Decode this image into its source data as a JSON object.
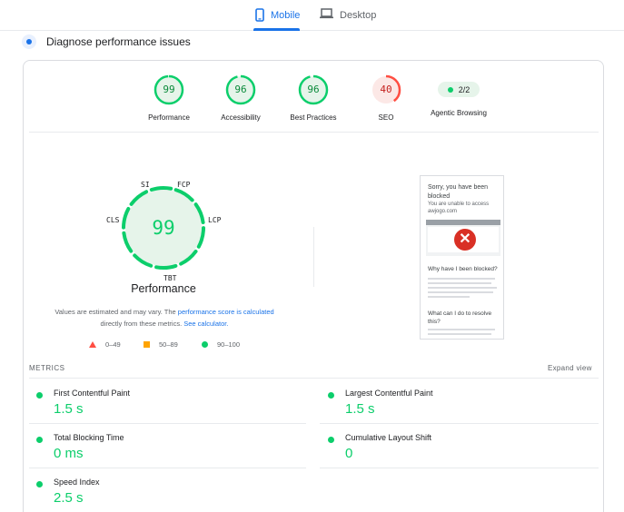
{
  "tabs": [
    {
      "label": "Mobile",
      "icon": "smartphone-icon",
      "active": true
    },
    {
      "label": "Desktop",
      "icon": "laptop-icon",
      "active": false
    }
  ],
  "diagnose": {
    "title": "Diagnose performance issues"
  },
  "scores": [
    {
      "value": "99",
      "label": "Performance",
      "status": "pass"
    },
    {
      "value": "96",
      "label": "Accessibility",
      "status": "pass"
    },
    {
      "value": "96",
      "label": "Best Practices",
      "status": "pass"
    },
    {
      "value": "40",
      "label": "SEO",
      "status": "fail"
    }
  ],
  "agentic": {
    "value": "2/2",
    "label": "Agentic Browsing"
  },
  "gauge": {
    "score": "99",
    "title": "Performance",
    "segments": {
      "si": "SI",
      "fcp": "FCP",
      "lcp": "LCP",
      "tbt": "TBT",
      "cls": "CLS"
    }
  },
  "note": {
    "text1": "Values are estimated and may vary. The ",
    "link1": "performance score is calculated",
    "text2": " directly from these metrics. ",
    "link2": "See calculator."
  },
  "legend": {
    "fail": "0–49",
    "average": "50–89",
    "pass": "90–100"
  },
  "thumbnail": {
    "title": "Sorry, you have been blocked",
    "subtitle": "You are unable to access awjogo.com",
    "heading1": "Why have I been blocked?",
    "heading2": "What can I do to resolve this?"
  },
  "metrics": {
    "header": "METRICS",
    "expand_label": "Expand view",
    "items": [
      {
        "name": "First Contentful Paint",
        "value": "1.5 s"
      },
      {
        "name": "Largest Contentful Paint",
        "value": "1.5 s"
      },
      {
        "name": "Total Blocking Time",
        "value": "0 ms"
      },
      {
        "name": "Cumulative Layout Shift",
        "value": "0"
      },
      {
        "name": "Speed Index",
        "value": "2.5 s"
      }
    ]
  },
  "colors": {
    "pass": "#0cce6b",
    "average": "#ffa400",
    "fail": "#ff4e42",
    "accent": "#1a73e8"
  }
}
